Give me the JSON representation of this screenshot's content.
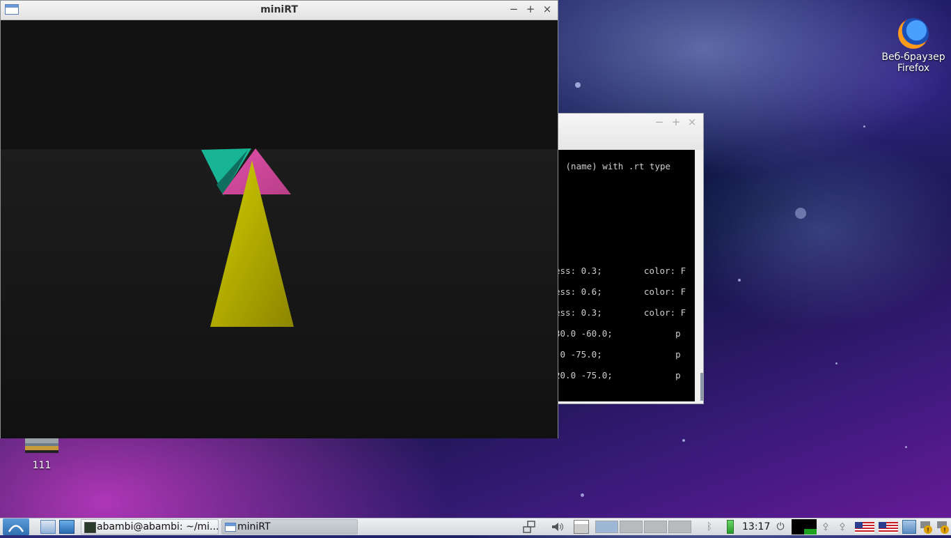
{
  "desktop": {
    "icons": [
      {
        "label_line1": "Веб-браузер",
        "label_line2": "Firefox",
        "icon": "firefox-icon"
      },
      {
        "label": "111",
        "icon": "image-file-icon"
      }
    ]
  },
  "minirt_window": {
    "title": "miniRT",
    "controls": {
      "minimize": "−",
      "maximize": "+",
      "close": "×"
    },
    "render": {
      "shapes": [
        {
          "name": "teal-triangle",
          "color": "#17b593"
        },
        {
          "name": "pink-triangle",
          "color": "#cf4a9a"
        },
        {
          "name": "yellow-triangle",
          "color": "#c6c000"
        }
      ]
    }
  },
  "terminal_window": {
    "controls": {
      "minimize": "−",
      "maximize": "+",
      "close": "×"
    },
    "lines": [
      " (name) with .rt type",
      "ess: 0.3;        color: F",
      "ess: 0.6;        color: F",
      "ess: 0.3;        color: F",
      "30.0 -60.0;            p",
      " 0 -75.0;              p",
      "20.0 -75.0;            p"
    ]
  },
  "taskbar": {
    "tasks": [
      {
        "label": "abambi@abambi: ~/mi...",
        "icon": "terminal-icon"
      },
      {
        "label": "miniRT",
        "icon": "window-icon",
        "active": true
      }
    ],
    "clock": "13:17"
  }
}
